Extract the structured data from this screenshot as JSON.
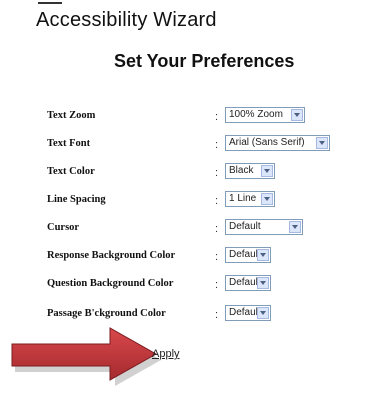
{
  "header": {
    "app_title": "Accessibility Wizard",
    "heading": "Set Your Preferences"
  },
  "preferences": [
    {
      "label": "Text Zoom",
      "value": "100% Zoom"
    },
    {
      "label": "Text Font",
      "value": "Arial (Sans Serif)"
    },
    {
      "label": "Text Color",
      "value": "Black"
    },
    {
      "label": "Line Spacing",
      "value": "1 Line"
    },
    {
      "label": "Cursor",
      "value": "Default"
    },
    {
      "label": "Response Background Color",
      "value": "Default"
    },
    {
      "label": "Question Background Color",
      "value": "Default"
    },
    {
      "label": "Passage B'ckground Color",
      "value": "Default"
    }
  ],
  "separator": ":",
  "actions": {
    "apply_label": "Apply"
  },
  "icons": {
    "annotation": "right-arrow-icon",
    "dropdown": "chevron-down-icon"
  },
  "colors": {
    "arrow_fill": "#c0343a",
    "select_border": "#7f9db9",
    "select_button": "#dbe6fb"
  }
}
